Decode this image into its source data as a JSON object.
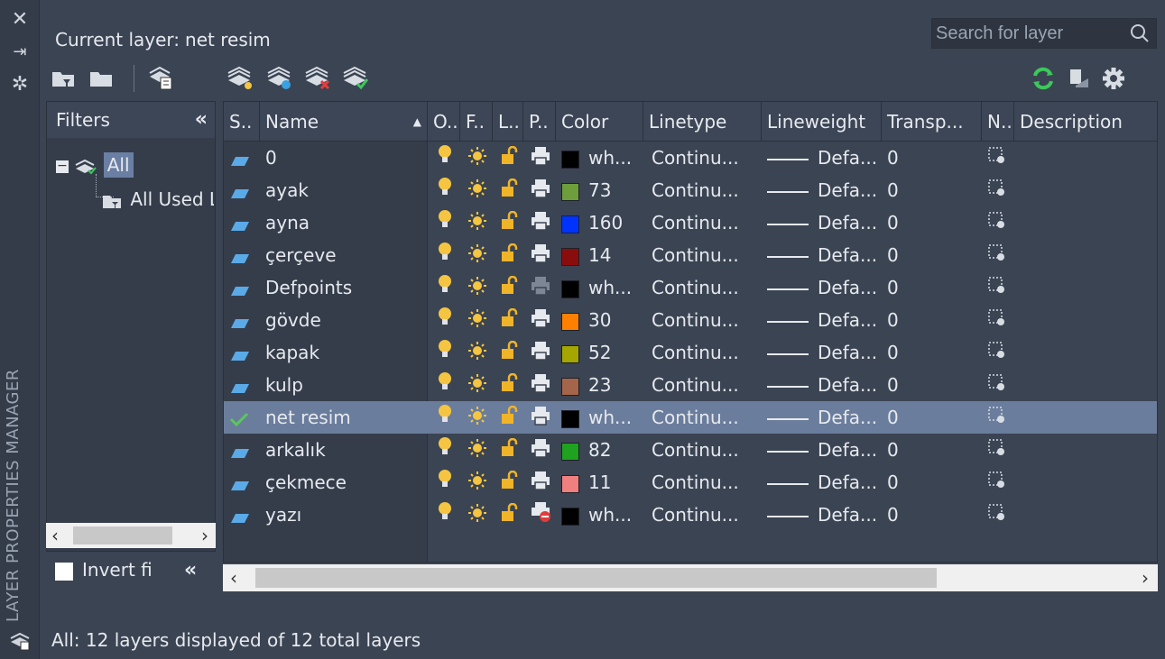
{
  "palette": {
    "title": "LAYER PROPERTIES MANAGER",
    "icons": [
      "close-icon",
      "auto-hide-icon",
      "properties-icon",
      "layer-panel-icon"
    ]
  },
  "header": {
    "current_layer_label": "Current layer:",
    "current_layer_name": "net resim",
    "search_placeholder": "Search for layer"
  },
  "toolbar": {
    "left_icons": [
      "new-property-filter-icon",
      "new-group-filter-icon",
      "layer-states-manager-icon"
    ],
    "layer_icons": [
      "new-layer-icon",
      "new-layer-vp-frozen-icon",
      "delete-layer-icon",
      "set-current-icon"
    ],
    "right_icons": [
      "refresh-icon",
      "layer-settings-icon",
      "settings-gear-icon"
    ]
  },
  "filters": {
    "title": "Filters",
    "tree": [
      {
        "label": "All",
        "selected": true
      },
      {
        "label": "All Used Layers",
        "selected": false
      }
    ],
    "invert_label": "Invert fi"
  },
  "grid": {
    "columns": [
      {
        "key": "status",
        "label": "S.."
      },
      {
        "key": "name",
        "label": "Name"
      },
      {
        "key": "on",
        "label": "O.."
      },
      {
        "key": "freeze",
        "label": "F.."
      },
      {
        "key": "lock",
        "label": "L.."
      },
      {
        "key": "plot",
        "label": "P.."
      },
      {
        "key": "color",
        "label": "Color"
      },
      {
        "key": "linetype",
        "label": "Linetype"
      },
      {
        "key": "lineweight",
        "label": "Lineweight"
      },
      {
        "key": "transparency",
        "label": "Transp..."
      },
      {
        "key": "newvp",
        "label": "N.."
      },
      {
        "key": "description",
        "label": "Description"
      }
    ],
    "rows": [
      {
        "name": "0",
        "current": false,
        "plot_disabled": false,
        "plot_gray": false,
        "color_hex": "#000000",
        "color_text": "wh...",
        "linetype": "Continu...",
        "lineweight": "Defa...",
        "transparency": "0"
      },
      {
        "name": "ayak",
        "current": false,
        "plot_disabled": false,
        "plot_gray": false,
        "color_hex": "#6e9e3c",
        "color_text": "73",
        "linetype": "Continu...",
        "lineweight": "Defa...",
        "transparency": "0"
      },
      {
        "name": "ayna",
        "current": false,
        "plot_disabled": false,
        "plot_gray": false,
        "color_hex": "#0033ff",
        "color_text": "160",
        "linetype": "Continu...",
        "lineweight": "Defa...",
        "transparency": "0"
      },
      {
        "name": "çerçeve",
        "current": false,
        "plot_disabled": false,
        "plot_gray": false,
        "color_hex": "#8a0d0d",
        "color_text": "14",
        "linetype": "Continu...",
        "lineweight": "Defa...",
        "transparency": "0"
      },
      {
        "name": "Defpoints",
        "current": false,
        "plot_disabled": false,
        "plot_gray": true,
        "color_hex": "#000000",
        "color_text": "wh...",
        "linetype": "Continu...",
        "lineweight": "Defa...",
        "transparency": "0"
      },
      {
        "name": "gövde",
        "current": false,
        "plot_disabled": false,
        "plot_gray": false,
        "color_hex": "#ff7f00",
        "color_text": "30",
        "linetype": "Continu...",
        "lineweight": "Defa...",
        "transparency": "0"
      },
      {
        "name": "kapak",
        "current": false,
        "plot_disabled": false,
        "plot_gray": false,
        "color_hex": "#a5a600",
        "color_text": "52",
        "linetype": "Continu...",
        "lineweight": "Defa...",
        "transparency": "0"
      },
      {
        "name": "kulp",
        "current": false,
        "plot_disabled": false,
        "plot_gray": false,
        "color_hex": "#a5654a",
        "color_text": "23",
        "linetype": "Continu...",
        "lineweight": "Defa...",
        "transparency": "0"
      },
      {
        "name": "net resim",
        "current": true,
        "plot_disabled": false,
        "plot_gray": false,
        "color_hex": "#000000",
        "color_text": "wh...",
        "linetype": "Continu...",
        "lineweight": "Defa...",
        "transparency": "0"
      },
      {
        "name": "arkalık",
        "current": false,
        "plot_disabled": false,
        "plot_gray": false,
        "color_hex": "#1fa21f",
        "color_text": "82",
        "linetype": "Continu...",
        "lineweight": "Defa...",
        "transparency": "0"
      },
      {
        "name": "çekmece",
        "current": false,
        "plot_disabled": false,
        "plot_gray": false,
        "color_hex": "#f07f7f",
        "color_text": "11",
        "linetype": "Continu...",
        "lineweight": "Defa...",
        "transparency": "0"
      },
      {
        "name": "yazı",
        "current": false,
        "plot_disabled": true,
        "plot_gray": false,
        "color_hex": "#000000",
        "color_text": "wh...",
        "linetype": "Continu...",
        "lineweight": "Defa...",
        "transparency": "0"
      }
    ]
  },
  "status_bar": {
    "text": "All: 12 layers displayed of 12 total layers"
  },
  "colors": {
    "panel_bg": "#3b4453",
    "selected_row": "#6b7d9c",
    "accent_bulb": "#f5c542",
    "lock_color": "#f0b429",
    "refresh_green": "#3cc85a"
  }
}
